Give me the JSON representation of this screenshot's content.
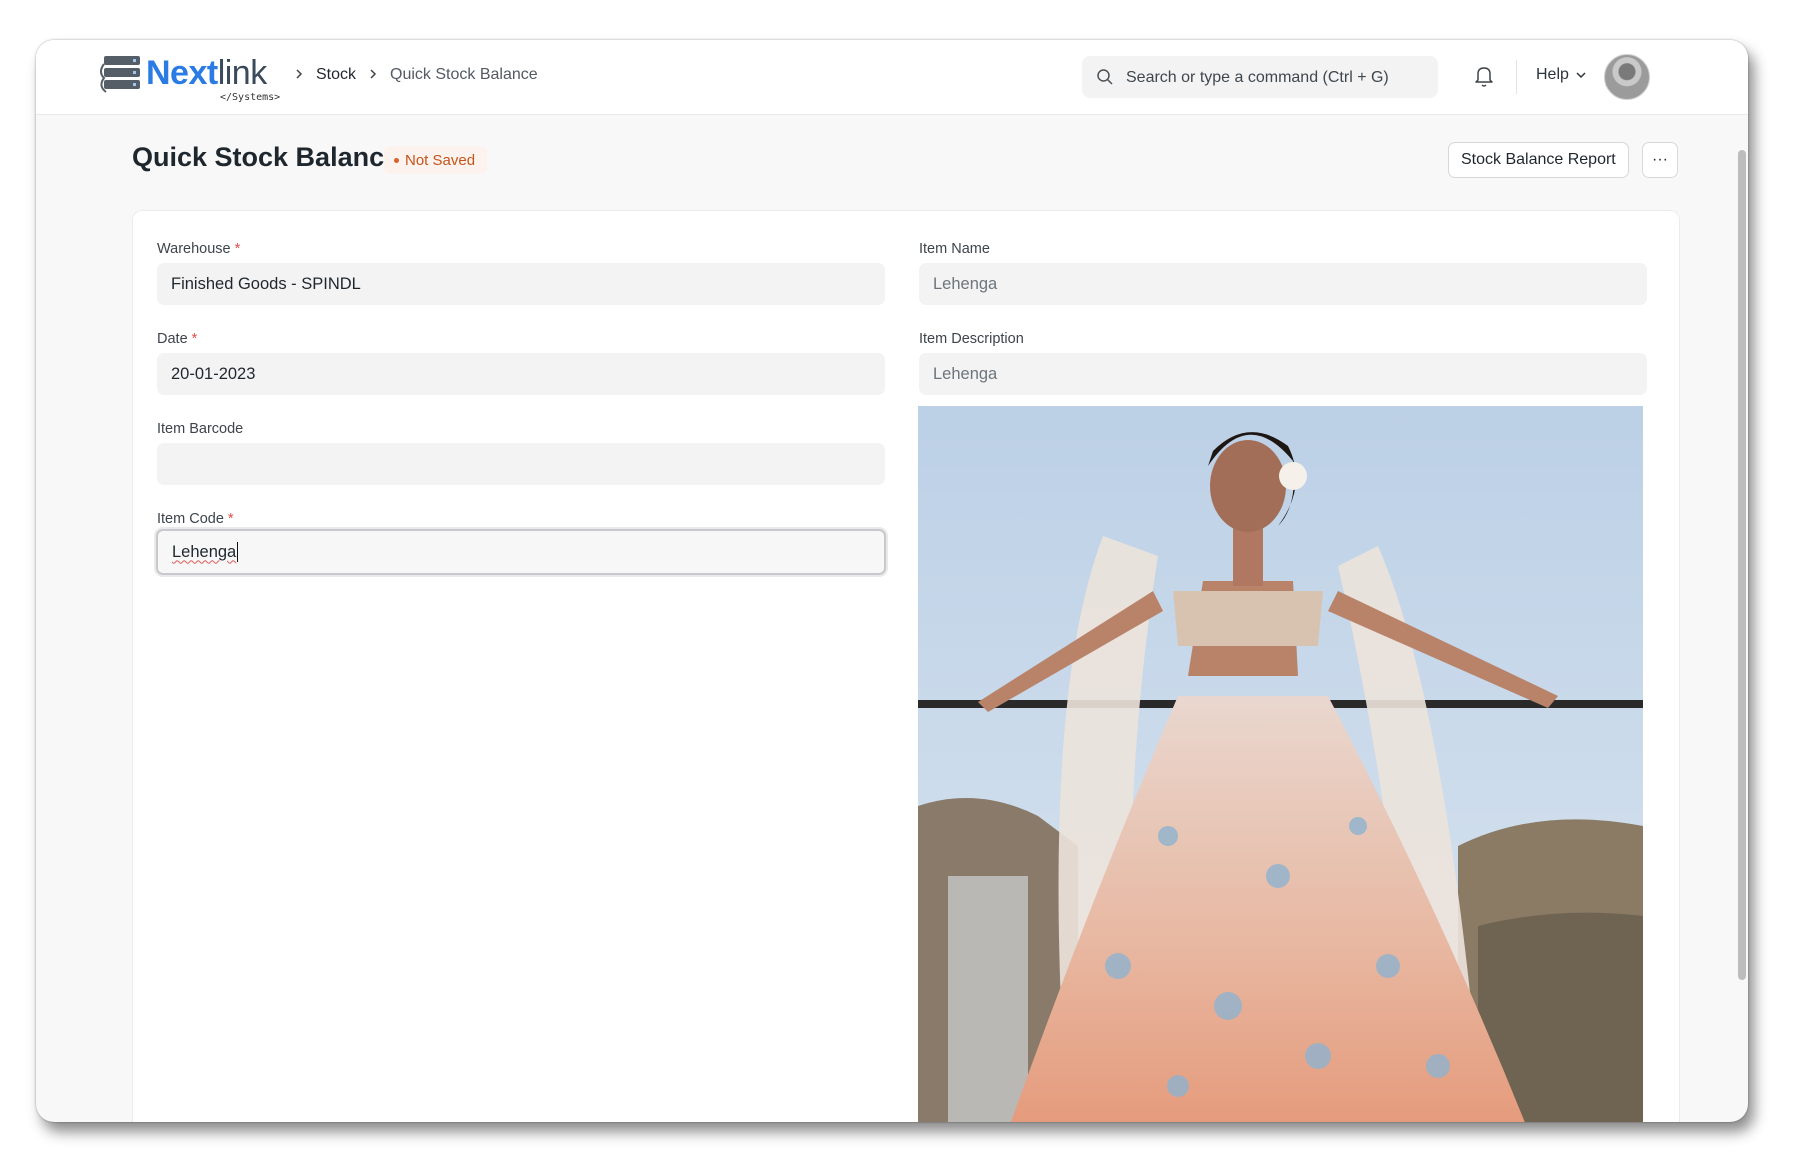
{
  "navbar": {
    "logo": {
      "brand_a": "Next",
      "brand_b": "link",
      "subtitle": "</Systems>"
    },
    "breadcrumb": [
      {
        "label": "Stock"
      },
      {
        "label": "Quick Stock Balance"
      }
    ],
    "search": {
      "placeholder": "Search or type a command (Ctrl + G)"
    },
    "help_label": "Help",
    "icons": [
      "search-icon",
      "bell-icon",
      "chevron-down-icon",
      "avatar"
    ]
  },
  "page": {
    "title": "Quick Stock Balance",
    "status": "Not Saved",
    "report_button": "Stock Balance Report",
    "more_button": "···"
  },
  "form": {
    "warehouse": {
      "label": "Warehouse",
      "required": "*",
      "value": "Finished Goods - SPINDL"
    },
    "date": {
      "label": "Date",
      "required": "*",
      "value": "20-01-2023"
    },
    "item_barcode": {
      "label": "Item Barcode",
      "value": ""
    },
    "item_code": {
      "label": "Item Code",
      "required": "*",
      "value": "Lehenga"
    },
    "item_name": {
      "label": "Item Name",
      "value": "Lehenga"
    },
    "item_description": {
      "label": "Item Description",
      "value": "Lehenga"
    }
  },
  "colors": {
    "brand_blue": "#2a7be4",
    "status_orange": "#c4541b",
    "required_red": "#e24c4c"
  }
}
